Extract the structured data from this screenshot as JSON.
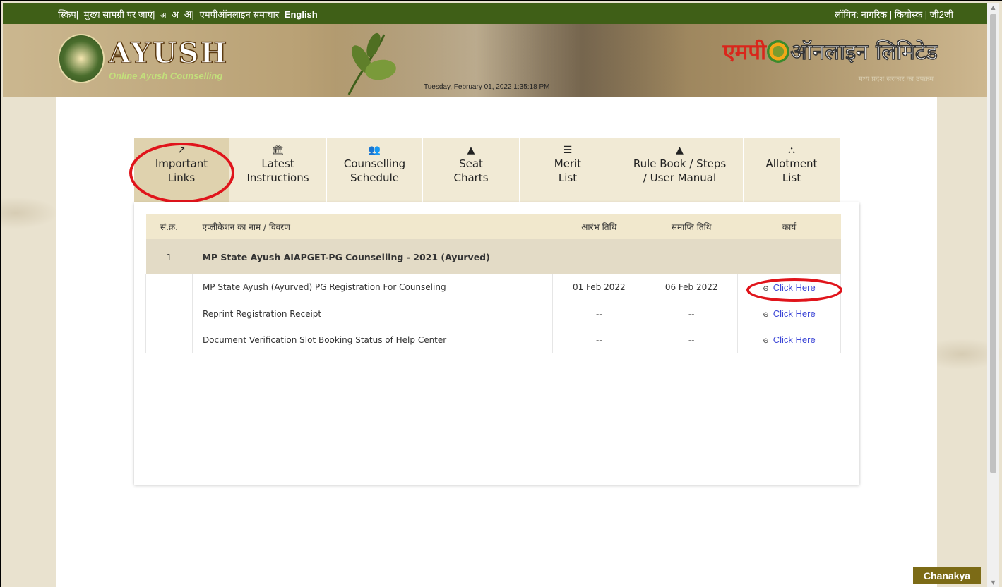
{
  "topbar": {
    "skip": "स्किप|",
    "main_content": "मुख्य सामग्री पर जाएं|",
    "font_small": "अ",
    "font_normal": "अ",
    "font_large": "अ|",
    "news": "एमपीऑनलाइन समाचार",
    "english": "English",
    "login_label": "लॉगिन:",
    "login_citizen": "नागरिक",
    "sep1": "|",
    "login_kiosk": "कियोस्क",
    "sep2": "|",
    "login_g2g": "जी2जी"
  },
  "header": {
    "title": "AYUSH",
    "subtitle": "Online Ayush Counselling",
    "datetime": "Tuesday, February 01, 2022 1:35:18 PM",
    "mp_red": "एमपी",
    "mp_white": "ऑनलाइन लिमिटेड",
    "mp_tagline": "मध्य प्रदेश सरकार का उपक्रम"
  },
  "tabs": [
    {
      "icon": "external-link-icon",
      "glyph": "↗",
      "line1": "Important",
      "line2": "Links",
      "active": true
    },
    {
      "icon": "bank-icon",
      "glyph": "🏛",
      "line1": "Latest",
      "line2": "Instructions",
      "active": false
    },
    {
      "icon": "users-icon",
      "glyph": "👥",
      "line1": "Counselling",
      "line2": "Schedule",
      "active": false
    },
    {
      "icon": "area-chart-icon",
      "glyph": "▲",
      "line1": "Seat",
      "line2": "Charts",
      "active": false
    },
    {
      "icon": "list-icon",
      "glyph": "☰",
      "line1": "Merit",
      "line2": "List",
      "active": false
    },
    {
      "icon": "area-chart-icon",
      "glyph": "▲",
      "line1": "Rule Book / Steps",
      "line2": "/ User Manual",
      "active": false
    },
    {
      "icon": "sitemap-icon",
      "glyph": "⛬",
      "line1": "Allotment",
      "line2": "List",
      "active": false
    }
  ],
  "table": {
    "headers": {
      "sno": "सं.क्र.",
      "name": "एप्लीकेशन का नाम / विवरण",
      "start": "आरंभ तिथि",
      "end": "समाप्ति तिथि",
      "action": "कार्य"
    },
    "group": {
      "sno": "1",
      "title": "MP State Ayush AIAPGET-PG Counselling - 2021 (Ayurved)"
    },
    "rows": [
      {
        "name": "MP State Ayush (Ayurved) PG Registration For Counseling",
        "start": "01 Feb 2022",
        "end": "06 Feb 2022",
        "action": "Click Here"
      },
      {
        "name": "Reprint Registration Receipt",
        "start": "--",
        "end": "--",
        "action": "Click Here"
      },
      {
        "name": "Document Verification Slot Booking Status of Help Center",
        "start": "--",
        "end": "--",
        "action": "Click Here"
      }
    ]
  },
  "footer": {
    "chanakya": "Chanakya"
  }
}
